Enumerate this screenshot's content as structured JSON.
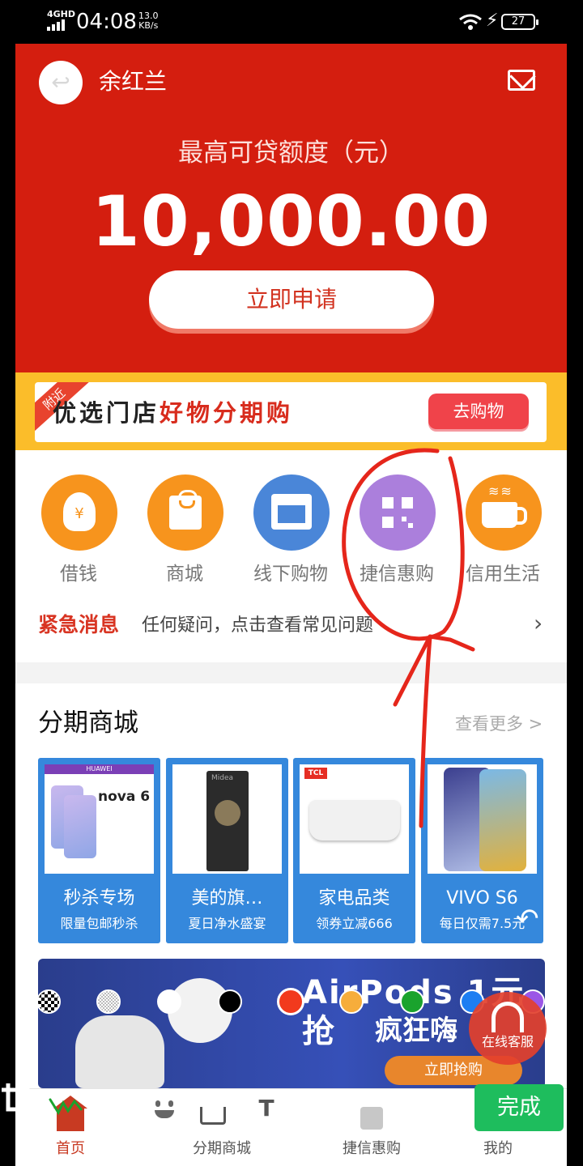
{
  "status_bar": {
    "network": "4GHD",
    "time": "04:08",
    "speed_value": "13.0",
    "speed_unit": "KB/s",
    "battery": "27"
  },
  "header": {
    "user_name": "余红兰"
  },
  "credit": {
    "label": "最高可贷额度（元）",
    "amount": "10,000.00",
    "apply_label": "立即申请"
  },
  "promo": {
    "ribbon": "附近",
    "title_part1": "优选门店",
    "title_part2": "好物分期购",
    "button_label": "去购物"
  },
  "menu": {
    "items": [
      {
        "label": "借钱",
        "color": "#f7941d",
        "icon": "money-bag-icon"
      },
      {
        "label": "商城",
        "color": "#f7941d",
        "icon": "shopping-bag-icon"
      },
      {
        "label": "线下购物",
        "color": "#4a86d8",
        "icon": "store-icon"
      },
      {
        "label": "捷信惠购",
        "color": "#ab7fdc",
        "icon": "qr-code-icon"
      },
      {
        "label": "信用生活",
        "color": "#f7941d",
        "icon": "coffee-cup-icon"
      }
    ]
  },
  "notice": {
    "tag": "紧急消息",
    "text": "任何疑问，点击查看常见问题"
  },
  "mall": {
    "title": "分期商城",
    "more_label": "查看更多 >",
    "cards": [
      {
        "title": "秒杀专场",
        "subtitle": "限量包邮秒杀",
        "image_text": "nova 6",
        "brand": "HUAWEI"
      },
      {
        "title": "美的旗…",
        "subtitle": "夏日净水盛宴",
        "brand": "Midea"
      },
      {
        "title": "家电品类",
        "subtitle": "领券立减666",
        "brand": "TCL"
      },
      {
        "title": "VIVO S6",
        "subtitle": "每日仅需7.5元"
      }
    ],
    "banner": {
      "title": "AirPods 1元抢",
      "subtitle": "疯狂嗨",
      "button_label": "立即抢购"
    }
  },
  "bottom_nav": {
    "items": [
      "首页",
      "分期商城",
      "捷信惠购",
      "我的"
    ]
  },
  "editor": {
    "swatches": [
      "mosaic",
      "blur",
      "#ffffff",
      "#000000",
      "#f23a1d",
      "#f6ad3b",
      "#1aa32d",
      "#1d7ef2",
      "#9b56e6"
    ],
    "done_label": "完成",
    "text_tool_label": "T",
    "cs_label": "在线客服",
    "annotation_color": "#e5261b"
  }
}
